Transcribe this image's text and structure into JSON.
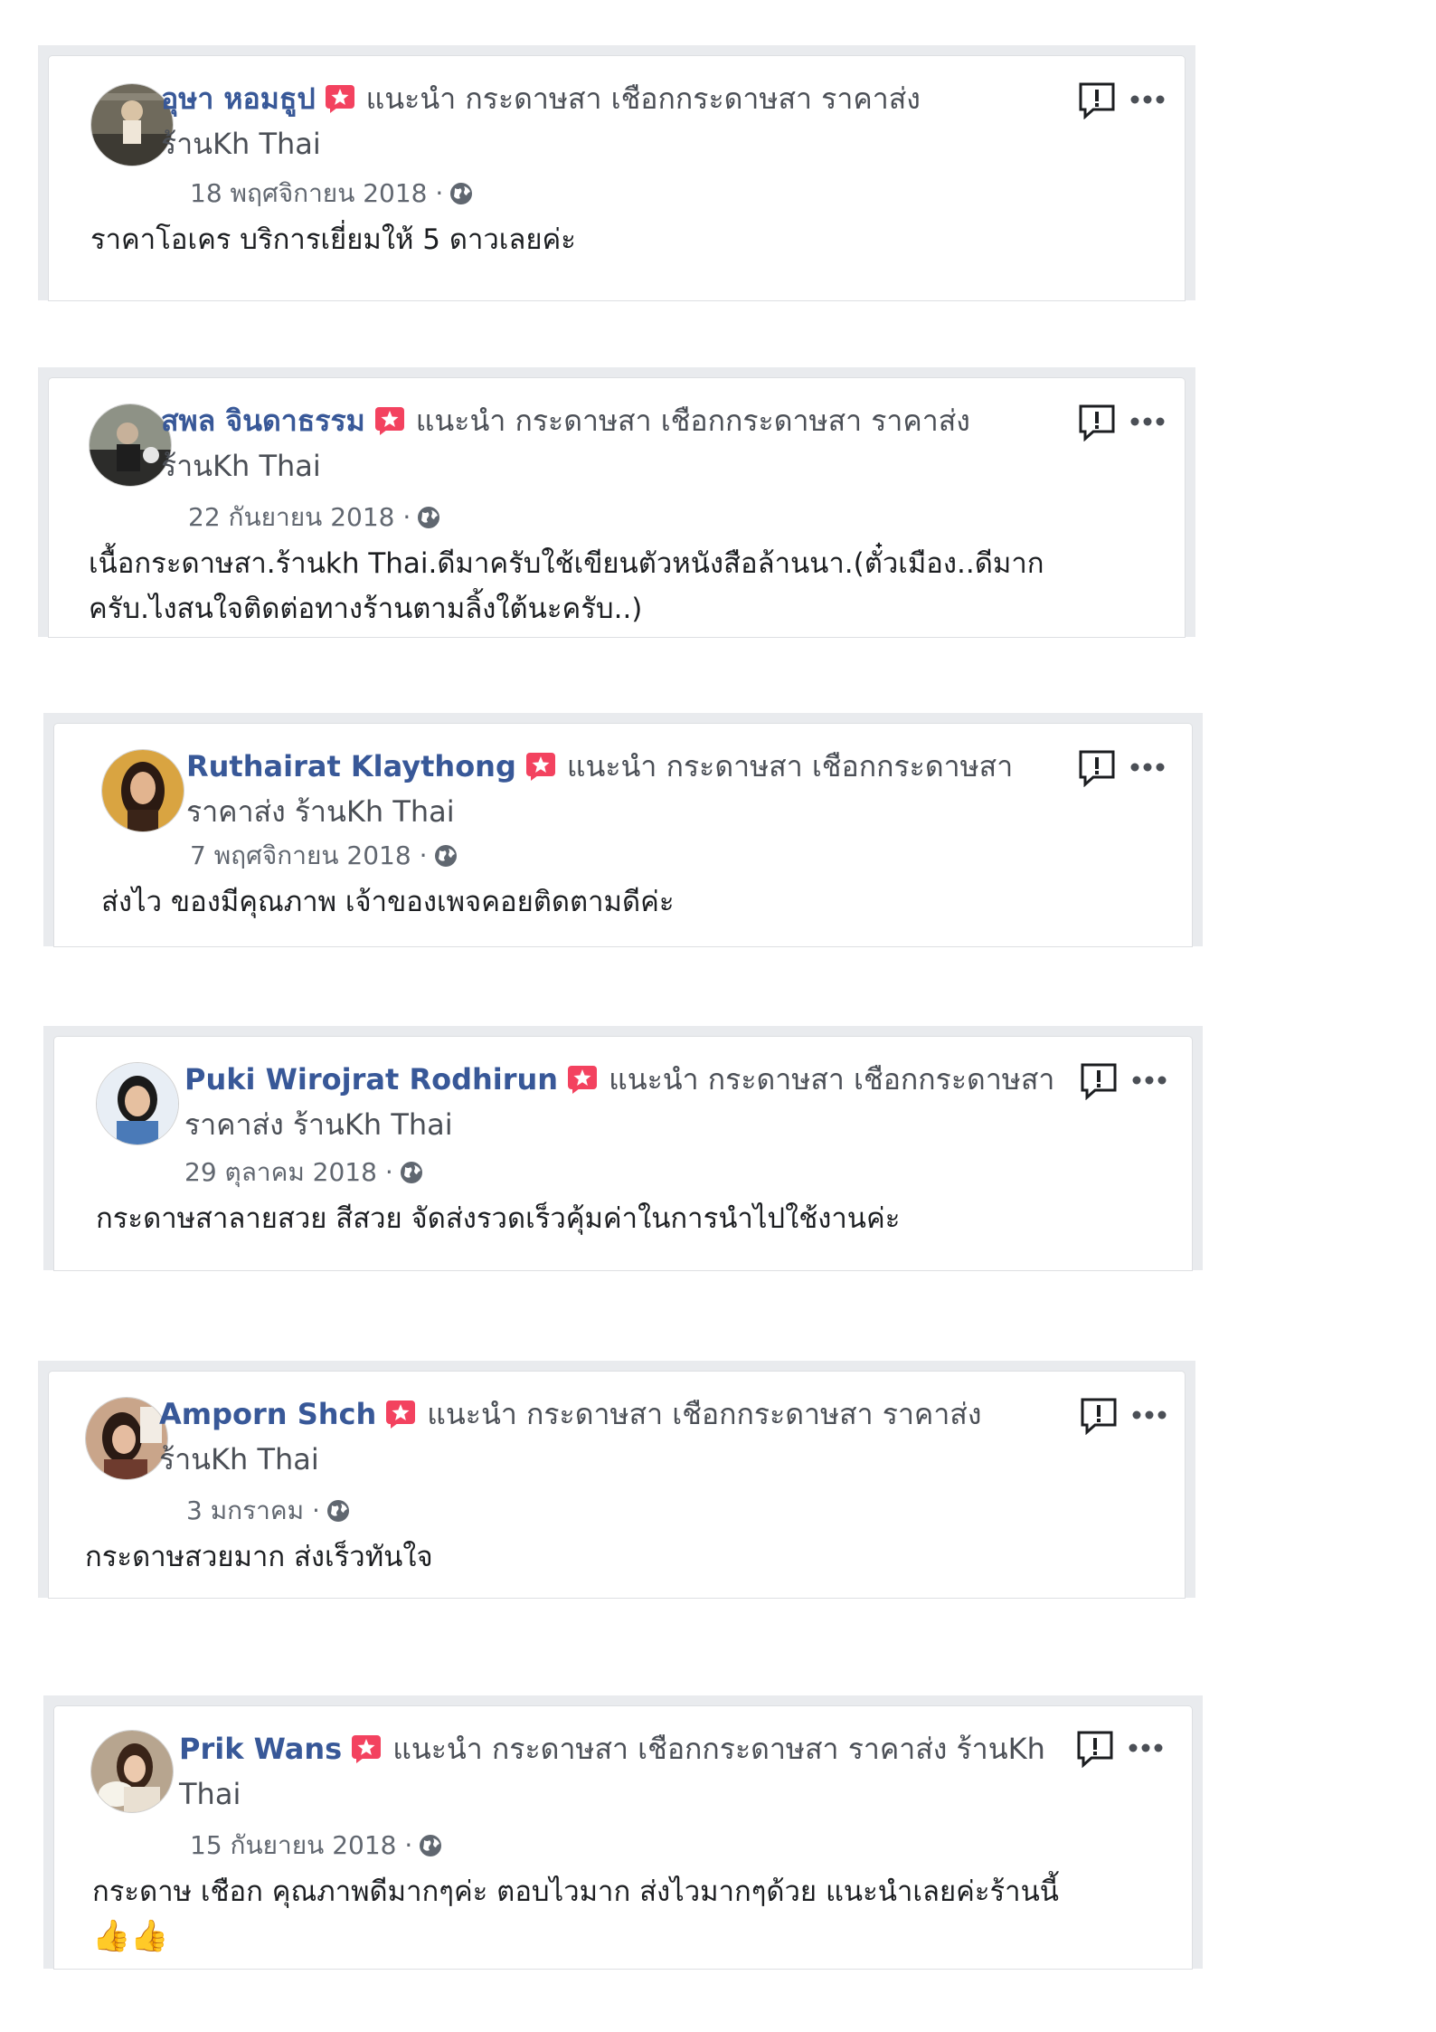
{
  "reviews": [
    {
      "name": "อุษา หอมธูป",
      "recommend_text": "แนะนำ กระดาษสา เชือกกระดาษสา ราคาส่ง",
      "page_name": "ร้านKh Thai",
      "date": "18 พฤศจิกายน 2018 ·",
      "text": "ราคาโอเคร บริการเยี่ยมให้ 5 ดาวเลยค่ะ"
    },
    {
      "name": "สพล จินดาธรรม",
      "recommend_text": "แนะนำ กระดาษสา เชือกกระดาษสา ราคาส่ง",
      "page_name": "ร้านKh Thai",
      "date": "22 กันยายน 2018 ·",
      "text_line1": "เนื้อกระดาษสา.ร้านkh Thai.ดีมาครับใช้เขียนตัวหนังสือล้านนา.(ตั๋วเมือง..ดีมาก",
      "text_line2": "ครับ.ไงสนใจติดต่อทางร้านตามลิ้งใต้นะครับ..)"
    },
    {
      "name": "Ruthairat Klaythong",
      "recommend_text": "แนะนำ กระดาษสา เชือกกระดาษสา",
      "page_name": "ราคาส่ง ร้านKh Thai",
      "date": "7 พฤศจิกายน 2018 ·",
      "text": "ส่งไว ของมีคุณภาพ เจ้าของเพจคอยติดตามดีค่ะ"
    },
    {
      "name": "Puki Wirojrat Rodhirun",
      "recommend_text": "แนะนำ กระดาษสา เชือกกระดาษสา",
      "page_name": "ราคาส่ง ร้านKh Thai",
      "date": "29 ตุลาคม 2018 ·",
      "text": "กระดาษสาลายสวย สีสวย จัดส่งรวดเร็วคุ้มค่าในการนำไปใช้งานค่ะ"
    },
    {
      "name": "Amporn Shch",
      "recommend_text": "แนะนำ กระดาษสา เชือกกระดาษสา ราคาส่ง",
      "page_name": "ร้านKh Thai",
      "date": "3 มกราคม ·",
      "text": "กระดาษสวยมาก ส่งเร็วทันใจ"
    },
    {
      "name": "Prik Wans",
      "recommend_text": "แนะนำ กระดาษสา เชือกกระดาษสา ราคาส่ง ร้านKh",
      "page_name": "Thai",
      "date": "15 กันยายน 2018 ·",
      "text": "กระดาษ เชือก คุณภาพดีมากๆค่ะ ตอบไวมาก ส่งไวมากๆด้วย แนะนำเลยค่ะร้านนี้",
      "emoji": "👍👍"
    }
  ],
  "colors": {
    "name": "#385898",
    "badge": "#f3425f",
    "frame": "#e9ebee"
  },
  "icons": {
    "recommend_badge": "recommend-badge-icon",
    "privacy": "globe-icon",
    "report": "report-icon",
    "more": "more-options-icon"
  }
}
